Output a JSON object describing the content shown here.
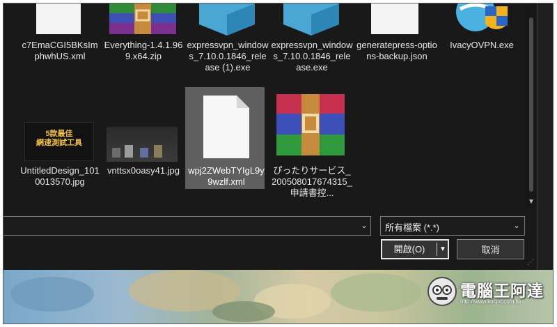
{
  "files_row1": [
    {
      "label": "c7EmaCGI5BKsImphwhUS.xml",
      "icon": "xml-file-icon"
    },
    {
      "label": "Everything-1.4.1.969.x64.zip",
      "icon": "winrar-archive-icon"
    },
    {
      "label": "expressvpn_windows_7.10.0.1846_release (1).exe",
      "icon": "installer-box-icon"
    },
    {
      "label": "expressvpn_windows_7.10.0.1846_release.exe",
      "icon": "installer-box-icon"
    },
    {
      "label": "generatepress-options-backup.json",
      "icon": "json-file-icon"
    },
    {
      "label": "IvacyOVPN.exe",
      "icon": "ivacy-shield-icon"
    }
  ],
  "files_row2": [
    {
      "label": "UntitledDesign_1010013570.jpg",
      "icon": "image-thumbnail",
      "thumb_text": "5款最佳\n網速測試工具"
    },
    {
      "label": "vnttsx0oasy41.jpg",
      "icon": "image-thumbnail"
    },
    {
      "label": "wpj2ZWebTYIgL9y9wzlf.xml",
      "icon": "blank-file-icon",
      "selected": true
    },
    {
      "label": "ぴったりサービス_200508017674315_申請書控...",
      "icon": "winrar-archive-icon"
    }
  ],
  "filename_input": {
    "value": ""
  },
  "filetype": {
    "selected": "所有檔案 (*.*)"
  },
  "buttons": {
    "open": "開啟(O)",
    "cancel": "取消"
  },
  "watermark": {
    "text": "電腦王阿達",
    "url": "http://www.kocpc.com.tw"
  },
  "colors": {
    "dialog_bg": "#191919",
    "selected_bg": "#5f5f5f",
    "text": "#e8e8e8"
  }
}
